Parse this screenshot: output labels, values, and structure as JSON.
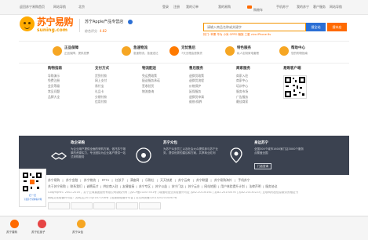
{
  "topbar": {
    "left": [
      "返回苏宁易购首页",
      "网站导航",
      "北京"
    ],
    "right": [
      "登录",
      "注册",
      "我的订单",
      "我的易购",
      "购物车",
      "手机苏宁",
      "我的苏宁",
      "客户服务",
      "网站导航"
    ],
    "cart_label": "购物车"
  },
  "header": {
    "logo_cn": "苏宁易购",
    "logo_en": "suning.com",
    "store_name": "苏宁Apple产品专营店",
    "store_rating_label": "综合评分",
    "store_rating": "4.82",
    "search_placeholder": "请输入商品名称或关键字",
    "search_button": "搜全站",
    "search_here_button": "搜本店",
    "hot_words": "热门: 苹果 华为 小米 OPPO 魅族 三星 vivo iPhone 6s"
  },
  "services": [
    {
      "title": "正品保障",
      "desc": "正品保障，提供发票"
    },
    {
      "title": "急速物流",
      "desc": "急速物流，急速送达"
    },
    {
      "title": "无忧售后",
      "desc": "7天无理由退换货"
    },
    {
      "title": "特色服务",
      "desc": "私人定制家电套餐"
    },
    {
      "title": "帮助中心",
      "desc": "您的购物指南"
    }
  ],
  "link_columns": [
    {
      "heading": "购物指南",
      "items": [
        "导购演示",
        "免费注册",
        "会员等级",
        "常见问题",
        "品牌大全"
      ]
    },
    {
      "heading": "支付方式",
      "items": [
        "货到付款",
        "网上支付",
        "易付宝",
        "礼品卡",
        "分期付款",
        "信用付款"
      ]
    },
    {
      "heading": "物流配送",
      "items": [
        "免运费政策",
        "配送服务承诺",
        "签收验货",
        "物流查询"
      ]
    },
    {
      "heading": "售后服务",
      "items": [
        "退换货政策",
        "退换货流程",
        "价格保护",
        "延保服务",
        "退换货申请",
        "维修/保养"
      ]
    },
    {
      "heading": "商家服务",
      "items": [
        "商家入驻",
        "商家中心",
        "培训中心",
        "服务市场",
        "广告服务",
        "最佳商家"
      ]
    },
    {
      "heading": "易购客户端",
      "items": []
    }
  ],
  "band": [
    {
      "title": "政企采购",
      "desc": "为企业用户提供全面的采购方案，依托苏宁雄厚的资源实力，专业团队为企业客户提供一站式采购服务"
    },
    {
      "title": "苏宁众包",
      "desc": "为苏宁众多员工以及社会大众提供参与苏宁业务，提供优秀的建议和方案，共享商业红利"
    },
    {
      "title": "身边苏宁",
      "desc": "全国300个城市1600家门店3000个服务点覆盖全国",
      "button": "门店查询"
    }
  ],
  "footer": {
    "brand_links": [
      "苏宁易购",
      "苏宁金融",
      "苏宁物流",
      "PPTV",
      "红孩子",
      "满座网",
      "乐购仕",
      "天天快递",
      "苏宁云商",
      "苏宁联盟",
      "苏宁易购海外",
      "手机苏宁"
    ],
    "info_links": [
      "关于苏宁易购",
      "联系我们",
      "诚聘英才",
      "供应商入驻",
      "友情链接",
      "苏宁专区",
      "苏宁公益",
      "苏宁门店",
      "苏宁云台",
      "网站地图",
      "用户体验提升计划",
      "法律声明",
      "服务协议"
    ],
    "copyright": "Copyright© 2002-2016 ，苏宁云商集团股份有限公司版权所有 | 苏ICP备10207551号 | 增值电信业务经营许可证 苏B2-20130161 | 苏B2-20130076 | 苏B2-20130223 | 互联网药品信息服务资格证书",
    "license": "网络文化经营许可证：苏网文[2013]0187-008号 | 出版物经营许可证 | 苏公网安备32010202010067号"
  },
  "float_qr": {
    "caption": "扫一扫",
    "caption2": "下载苏宁易购客户端"
  },
  "bottombar": [
    {
      "label": "苏宁易购"
    },
    {
      "label": "苏宁红孩子"
    },
    {
      "label": "苏宁众包"
    }
  ]
}
